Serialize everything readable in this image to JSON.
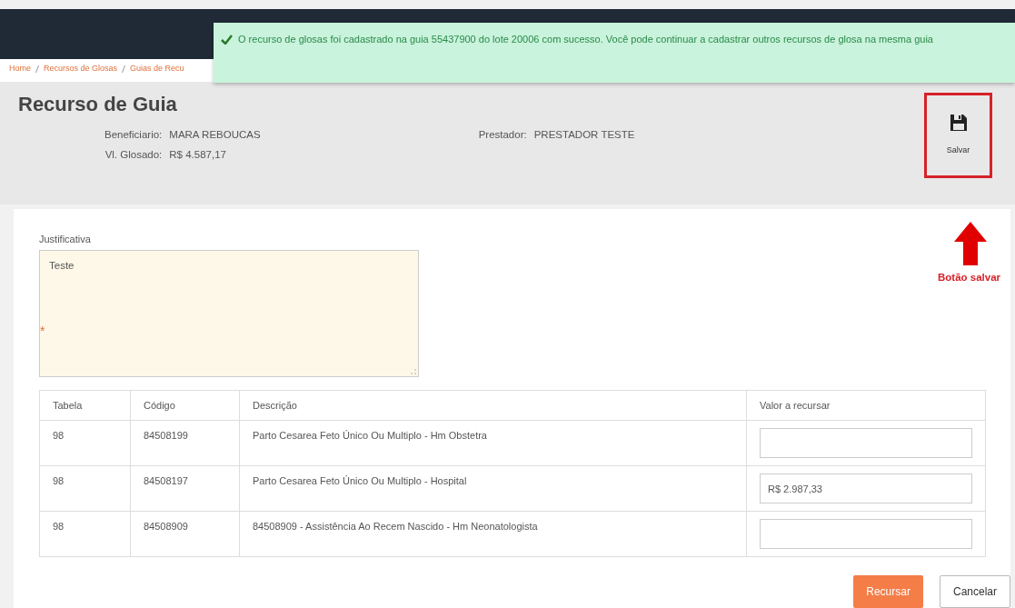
{
  "breadcrumb": [
    "Home",
    "Recursos de Glosas",
    "Guias de Recu"
  ],
  "toast": {
    "message": "O recurso de glosas foi cadastrado na guia 55437900 do lote 20006 com sucesso. Você pode continuar a cadastrar outros recursos de glosa na mesma guia"
  },
  "header": {
    "title": "Recurso de Guia",
    "fields": [
      {
        "label": "Beneficiario:",
        "value": "MARA REBOUCAS"
      },
      {
        "label": "Vl. Glosado:",
        "value": "R$ 4.587,17"
      },
      {
        "label": "Prestador:",
        "value": "PRESTADOR TESTE"
      }
    ],
    "save_button": "Salvar"
  },
  "annotation": {
    "label": "Botão salvar"
  },
  "form": {
    "label": "Justificativa",
    "value": "Teste",
    "required_mark": "*"
  },
  "table": {
    "columns": [
      "Tabela",
      "Código",
      "Descrição",
      "Valor a recursar"
    ],
    "rows": [
      {
        "tabela": "98",
        "codigo": "84508199",
        "descricao": "Parto Cesarea Feto Único Ou Multiplo - Hm Obstetra",
        "valor": ""
      },
      {
        "tabela": "98",
        "codigo": "84508197",
        "descricao": "Parto Cesarea Feto Único Ou Multiplo - Hospital",
        "valor": "R$ 2.987,33"
      },
      {
        "tabela": "98",
        "codigo": "84508909",
        "descricao": "84508909 - Assistência Ao Recem Nascido - Hm Neonatologista",
        "valor": ""
      }
    ]
  },
  "buttons": [
    {
      "label": "Recursar",
      "kind": "primary"
    },
    {
      "label": "Cancelar",
      "kind": "secondary"
    }
  ]
}
